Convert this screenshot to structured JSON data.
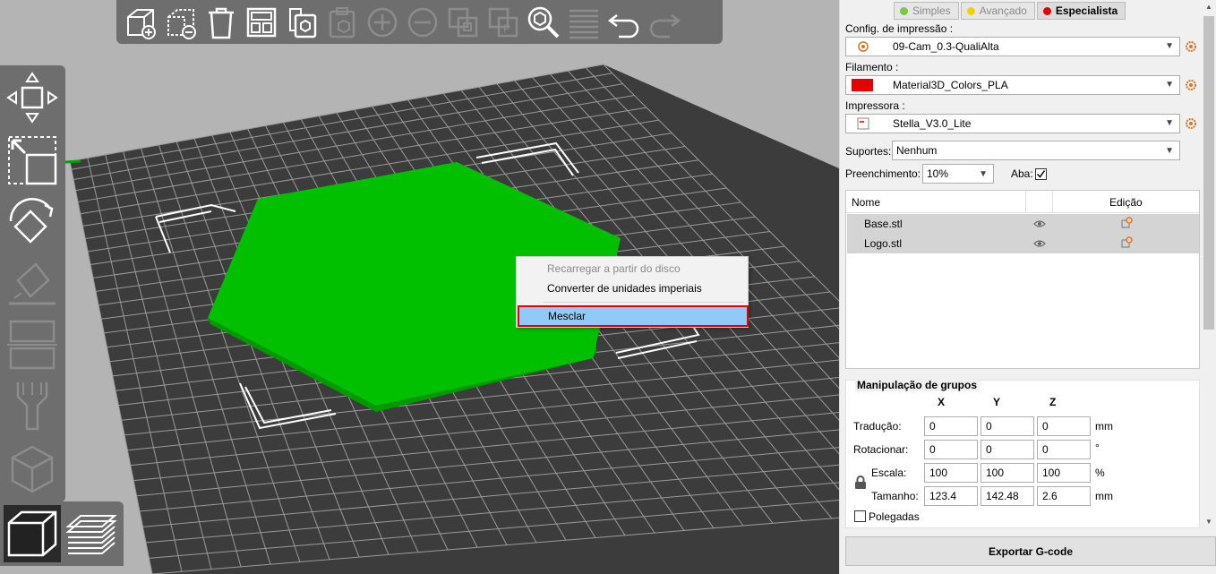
{
  "colors": {
    "viewport_bg": "#b4b4b4",
    "bed": "#3c3c3c",
    "model": "#00c000",
    "toolbar": "#6e6e6e",
    "menu_highlight": "#91c9f7",
    "menu_highlight_border": "#e0000b",
    "filament_swatch": "#e60000"
  },
  "toolbar_top": {
    "icons": [
      "add-object-icon",
      "delete-object-icon",
      "delete-all-icon",
      "arrange-icon",
      "copy-icon",
      "paste-icon",
      "add-instance-icon",
      "remove-instance-icon",
      "split-objects-icon",
      "split-parts-icon",
      "search-icon",
      "layers-editor-icon",
      "undo-icon",
      "redo-icon"
    ]
  },
  "toolbar_left": {
    "icons": [
      "move-icon",
      "scale-icon",
      "rotate-icon",
      "place-on-face-icon",
      "cut-icon",
      "paint-supports-icon",
      "seam-icon"
    ]
  },
  "context_menu": {
    "items": [
      {
        "label": "Recarregar a partir do disco",
        "enabled": false
      },
      {
        "label": "Converter de unidades imperiais",
        "enabled": true
      },
      {
        "label": "Mesclar",
        "enabled": true,
        "highlighted": true
      }
    ]
  },
  "sidebar": {
    "mode_tabs": [
      {
        "label": "Simples",
        "color": "#7ac943",
        "active": false
      },
      {
        "label": "Avançado",
        "color": "#f5d000",
        "active": false
      },
      {
        "label": "Especialista",
        "color": "#e60000",
        "active": true
      }
    ],
    "print_config": {
      "label": "Config. de impressão :",
      "value": "09-Cam_0.3-QualiAlta"
    },
    "filament": {
      "label": "Filamento :",
      "value": "Material3D_Colors_PLA"
    },
    "printer": {
      "label": "Impressora :",
      "value": "Stella_V3.0_Lite"
    },
    "supports": {
      "label": "Suportes:",
      "value": "Nenhum"
    },
    "infill": {
      "label": "Preenchimento:",
      "value": "10%"
    },
    "brim": {
      "label": "Aba:",
      "checked": true
    },
    "object_list": {
      "col_name": "Nome",
      "col_edit": "Edição",
      "rows": [
        {
          "name": "Base.stl"
        },
        {
          "name": "Logo.stl"
        }
      ]
    },
    "manipulation": {
      "title": "Manipulação de grupos",
      "axes": [
        "X",
        "Y",
        "Z"
      ],
      "translation": {
        "label": "Tradução:",
        "values": [
          "0",
          "0",
          "0"
        ],
        "unit": "mm"
      },
      "rotation": {
        "label": "Rotacionar:",
        "values": [
          "0",
          "0",
          "0"
        ],
        "unit": "°"
      },
      "scale": {
        "label": "Escala:",
        "values": [
          "100",
          "100",
          "100"
        ],
        "unit": "%"
      },
      "size": {
        "label": "Tamanho:",
        "values": [
          "123.4",
          "142.48",
          "2.6"
        ],
        "unit": "mm"
      },
      "inches": {
        "label": "Polegadas",
        "checked": false
      }
    },
    "export_button": "Exportar G-code"
  }
}
